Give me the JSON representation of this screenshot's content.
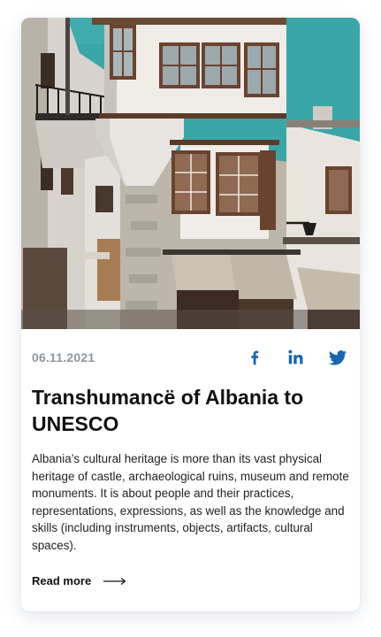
{
  "card": {
    "date": "06.11.2021",
    "title": "Transhumancë of Albania to UNESCO",
    "body": "Albania’s cultural heritage is more than its vast physical heritage of castle, archaeological ruins, museum and remote monuments. It is about people and their practices, representations, expressions, as well as the knowledge and skills (including instruments, objects, artifacts, cultural spaces).",
    "read_more_label": "Read more",
    "image_alt": "Stone houses with wooden bay windows in an old town"
  },
  "share": {
    "items": [
      {
        "name": "facebook",
        "icon": "facebook-icon"
      },
      {
        "name": "linkedin",
        "icon": "linkedin-icon"
      },
      {
        "name": "twitter",
        "icon": "twitter-icon"
      }
    ],
    "color": "#1767b0"
  },
  "colors": {
    "share_icons": "#1767b0",
    "date": "#8e969f",
    "title": "#111111",
    "sky": "#3aa6a8"
  }
}
